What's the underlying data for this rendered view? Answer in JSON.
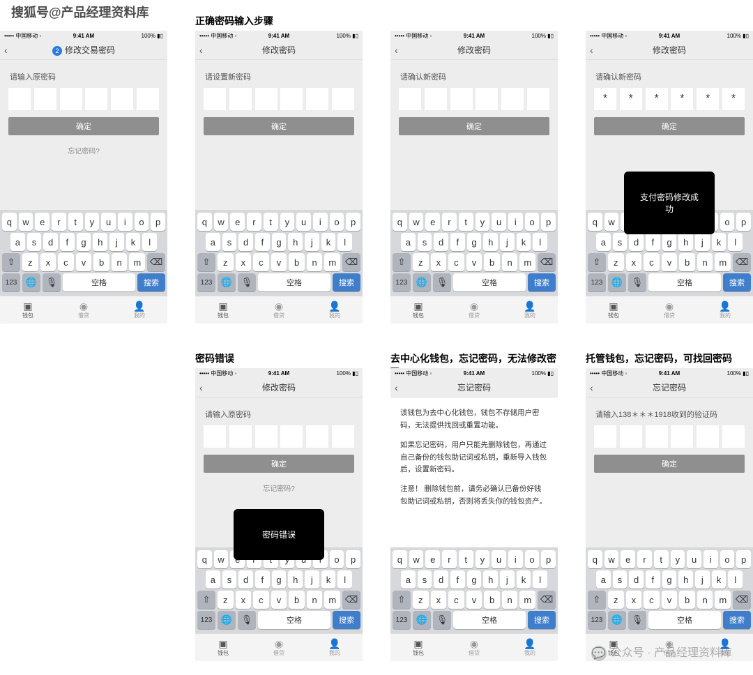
{
  "watermark_top": "搜狐号@产品经理资料库",
  "watermark_bottom": "公众号 · 产品经理资料库",
  "statusbar": {
    "carrier": "••••• 中国移动 ◦",
    "time": "9:41 AM",
    "batt": "100% ▮▯"
  },
  "tabs": [
    {
      "label": "钱包",
      "icon": "▣"
    },
    {
      "label": "借贷",
      "icon": "◉"
    },
    {
      "label": "我的",
      "icon": "👤"
    }
  ],
  "kb": {
    "r1": [
      "q",
      "w",
      "e",
      "r",
      "t",
      "y",
      "u",
      "i",
      "o",
      "p"
    ],
    "r2": [
      "a",
      "s",
      "d",
      "f",
      "g",
      "h",
      "j",
      "k",
      "l"
    ],
    "r3": [
      "z",
      "x",
      "c",
      "v",
      "b",
      "n",
      "m"
    ],
    "shift": "⇧",
    "del": "⌫",
    "num": "123",
    "globe": "🌐",
    "mic": "🎤",
    "space": "空格",
    "search": "搜索"
  },
  "screens": [
    {
      "caption": "",
      "nav": {
        "back": "‹",
        "badge": "2",
        "title": "修改交易密码"
      },
      "body": {
        "label": "请输入原密码",
        "boxes": [
          "",
          "",
          "",
          "",
          "",
          ""
        ],
        "confirm": "确定",
        "forgot": "忘记密码?"
      },
      "keyboard": true,
      "tabbar": true
    },
    {
      "caption": "正确密码输入步骤",
      "nav": {
        "back": "‹",
        "title": "修改密码"
      },
      "body": {
        "label": "请设置新密码",
        "boxes": [
          "",
          "",
          "",
          "",
          "",
          ""
        ],
        "confirm": "确定"
      },
      "keyboard": true,
      "tabbar": true
    },
    {
      "caption": "",
      "nav": {
        "back": "‹",
        "title": "修改密码"
      },
      "body": {
        "label": "请确认新密码",
        "boxes": [
          "",
          "",
          "",
          "",
          "",
          ""
        ],
        "confirm": "确定"
      },
      "keyboard": true,
      "tabbar": true
    },
    {
      "caption": "",
      "nav": {
        "back": "‹",
        "title": "修改密码"
      },
      "body": {
        "label": "请确认新密码",
        "boxes": [
          "*",
          "*",
          "*",
          "*",
          "*",
          "*"
        ],
        "confirm": "确定",
        "toast": "支付密码修改成功"
      },
      "keyboard": true,
      "tabbar": true
    },
    {
      "caption": "密码错误",
      "nav": {
        "back": "‹",
        "title": "修改密码"
      },
      "body": {
        "label": "请输入原密码",
        "boxes": [
          "",
          "",
          "",
          "",
          "",
          ""
        ],
        "confirm": "确定",
        "forgot": "忘记密码?",
        "toast": "密码错误"
      },
      "keyboard": true,
      "tabbar": true
    },
    {
      "caption": "去中心化钱包，忘记密码，无法修改密码",
      "nav": {
        "back": "‹",
        "title": "忘记密码"
      },
      "body": {
        "paragraphs": [
          "该钱包为去中心化钱包，钱包不存储用户密码，无法提供找回或重置功能。",
          "如果忘记密码，用户只能先删除钱包，再通过自己备份的钱包助记词或私钥，重新导入钱包后，设置新密码。",
          "注意！\n删除钱包前，请务必确认已备份好钱包助记词或私钥，否则将丢失你的钱包资产。"
        ]
      },
      "keyboard": true,
      "tabbar": true
    },
    {
      "caption": "托管钱包，忘记密码，可找回密码",
      "nav": {
        "back": "‹",
        "title": "忘记密码"
      },
      "body": {
        "label": "请输入138＊＊＊1918收到的验证码",
        "boxes": [
          "",
          "",
          "",
          "",
          "",
          ""
        ],
        "confirm": "确定"
      },
      "keyboard": true,
      "tabbar": true
    }
  ]
}
